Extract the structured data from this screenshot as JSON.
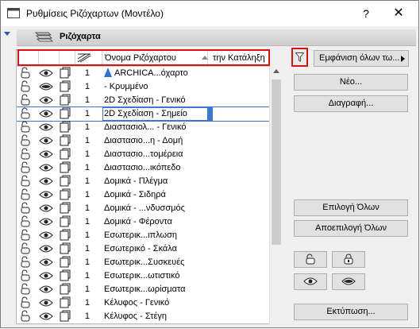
{
  "window": {
    "title": "Ρυθμίσεις Ριζόχαρτων (Μοντέλο)",
    "help_label": "?",
    "close_label": "✕"
  },
  "section": {
    "title": "Ριζόχαρτα"
  },
  "list": {
    "columns": {
      "name": "Όνομα Ριζόχαρτου",
      "extension": "την Κατάληξη"
    },
    "rows": [
      {
        "pen": "1",
        "name": "ARCHICA...όχαρτο",
        "archicad_icon": true
      },
      {
        "pen": "1",
        "name": "- Κρυμμένο",
        "hidden": true
      },
      {
        "pen": "1",
        "name": "2D Σχεδίαση - Γενικό"
      },
      {
        "pen": "1",
        "name": "2D Σχεδίαση - Σημείο",
        "selected": true
      },
      {
        "pen": "1",
        "name": "Διαστασιολ... - Γενικό"
      },
      {
        "pen": "1",
        "name": "Διαστασιο...η - Δομή"
      },
      {
        "pen": "1",
        "name": "Διαστασιο...τομέρεια"
      },
      {
        "pen": "1",
        "name": "Διαστασιο...ικόπεδο"
      },
      {
        "pen": "1",
        "name": "Δομικά - Πλέγμα"
      },
      {
        "pen": "1",
        "name": "Δομικά - Σιδηρά"
      },
      {
        "pen": "1",
        "name": "Δομικά - ...νδυσσμός"
      },
      {
        "pen": "1",
        "name": "Δομικά - Φέροντα"
      },
      {
        "pen": "1",
        "name": "Εσωτερικ...ιπλωση"
      },
      {
        "pen": "1",
        "name": "Εσωτερικό - Σκάλα"
      },
      {
        "pen": "1",
        "name": "Εσωτερικ...Συσκευές"
      },
      {
        "pen": "1",
        "name": "Εσωτερικ...ωτιστικό"
      },
      {
        "pen": "1",
        "name": "Εσωτερικ...ωρίσματα"
      },
      {
        "pen": "1",
        "name": "Κέλυφος - Γενικό"
      },
      {
        "pen": "1",
        "name": "Κέλυφος - Στέγη"
      }
    ]
  },
  "buttons": {
    "show_all": "Εμφάνιση όλων τω...",
    "new": "Νέο...",
    "delete": "Διαγραφή...",
    "select_all": "Επιλογή Όλων",
    "deselect_all": "Αποεπιλογή Όλων",
    "print": "Εκτύπωση..."
  },
  "colors": {
    "accent": "#3b78d4",
    "highlight": "#e01010"
  }
}
